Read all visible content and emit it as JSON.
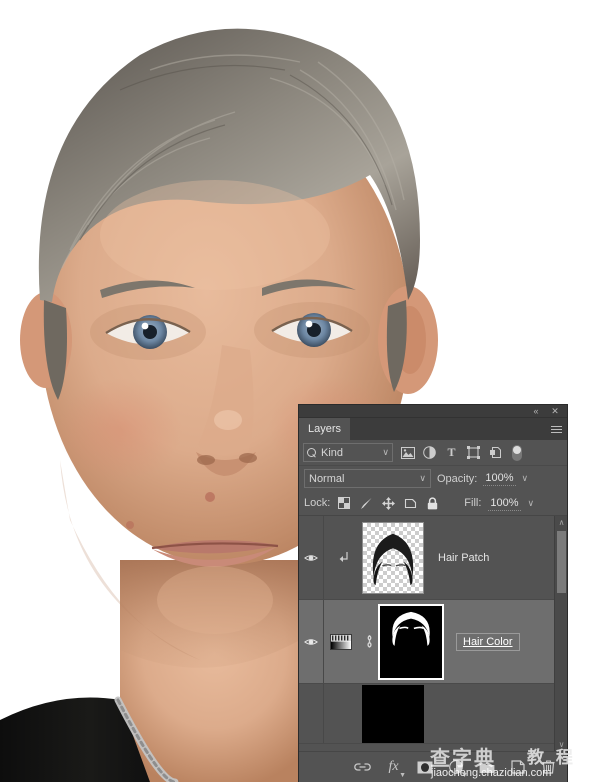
{
  "photo": {
    "description": "portrait-photo-man-graying-hair",
    "alt": "Head-and-shoulders portrait of a man with graying hair on a white background",
    "background_color": "#ffffff",
    "skin_color": "#d9a585",
    "hair_color": "#8c8277",
    "shirt_color": "#141414",
    "eye_color": "#6f86a0",
    "necklace_color": "#c9c9c9"
  },
  "panel": {
    "title": "Layers",
    "tab_label": "Layers",
    "window_controls": {
      "collapse_label": "«",
      "collapse_name": "collapse-to-icons",
      "close_label": "✕",
      "close_name": "close-panel"
    },
    "menu_label": "Panel Menu",
    "filter": {
      "search_icon": "search-icon",
      "kind_label": "Kind",
      "dropdown_caret": "∨",
      "icons": [
        {
          "name": "filter-pixel-layers-icon",
          "title": "Filter for pixel layers"
        },
        {
          "name": "filter-adjustment-layers-icon",
          "title": "Filter for adjustment layers"
        },
        {
          "name": "filter-type-layers-icon",
          "title": "Filter for type layers",
          "glyph": "T"
        },
        {
          "name": "filter-shape-layers-icon",
          "title": "Filter for shape layers"
        },
        {
          "name": "filter-smart-object-icon",
          "title": "Filter for smart objects"
        }
      ],
      "toggle_name": "filter-enable-toggle",
      "toggle_state": "on"
    },
    "blend": {
      "mode_label": "Normal",
      "mode_caret": "∨",
      "opacity_label": "Opacity:",
      "opacity_value": "100%",
      "opacity_caret": "∨"
    },
    "lock": {
      "label": "Lock:",
      "fill_label": "Fill:",
      "fill_value": "100%",
      "fill_caret": "∨",
      "icons": [
        {
          "name": "lock-transparent-pixels-icon",
          "title": "Lock transparent pixels"
        },
        {
          "name": "lock-image-pixels-icon",
          "title": "Lock image pixels"
        },
        {
          "name": "lock-position-icon",
          "title": "Lock position"
        },
        {
          "name": "lock-artboard-nesting-icon",
          "title": "Prevent auto-nesting"
        },
        {
          "name": "lock-all-icon",
          "title": "Lock all"
        }
      ]
    },
    "layers": [
      {
        "name": "Hair Patch",
        "visible": true,
        "selected": false,
        "clipped": true,
        "thumb_type": "transparent",
        "editing": false
      },
      {
        "name": "Hair Color",
        "visible": true,
        "selected": true,
        "clipped": false,
        "thumb_type": "mask",
        "adjustment_icon": "gradient-map-icon",
        "link_icon": "link-icon",
        "editing": true
      },
      {
        "name": "",
        "visible": true,
        "selected": false,
        "clipped": false,
        "thumb_type": "mask-partial",
        "editing": false
      }
    ],
    "scrollbar": {
      "up_arrow": "∧",
      "down_arrow": "∨",
      "name": "layers-vertical-scrollbar"
    },
    "bottom_toolbar": [
      {
        "name": "link-layers-button",
        "title": "Link layers"
      },
      {
        "name": "layer-style-fx-button",
        "title": "Add a layer style",
        "glyph": "fx"
      },
      {
        "name": "add-layer-mask-button",
        "title": "Add layer mask"
      },
      {
        "name": "new-adjustment-layer-button",
        "title": "Create new fill or adjustment layer"
      },
      {
        "name": "new-group-button",
        "title": "Create a new group"
      },
      {
        "name": "new-layer-button",
        "title": "Create a new layer"
      },
      {
        "name": "delete-layer-button",
        "title": "Delete layer"
      }
    ]
  },
  "watermark": {
    "cn_primary": "查字典",
    "cn_secondary": "教 程",
    "url": "jiaocheng.chazidian.com"
  }
}
